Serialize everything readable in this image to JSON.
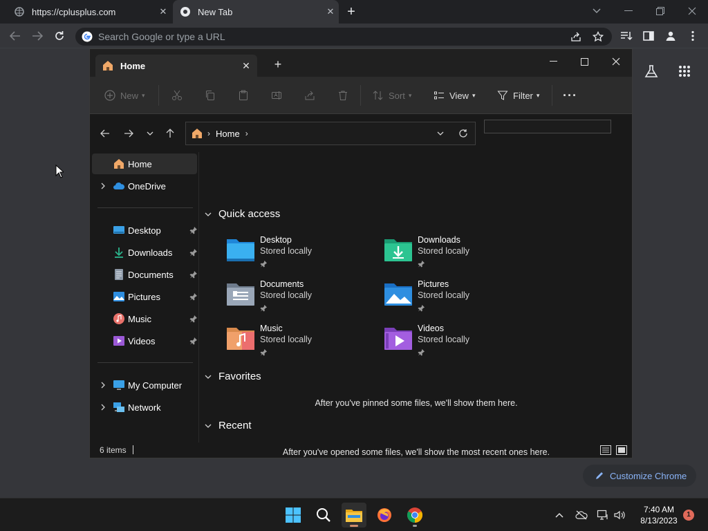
{
  "chrome": {
    "tabs": [
      {
        "label": "https://cplusplus.com",
        "close": "✕"
      },
      {
        "label": "New Tab",
        "close": "✕"
      }
    ],
    "newtab": "+",
    "omnibox": {
      "placeholder": "Search Google or type a URL"
    },
    "customize": "Customize Chrome"
  },
  "explorer": {
    "tab_title": "Home",
    "tab_close": "✕",
    "new_tab": "+",
    "commands": {
      "new": "New",
      "sort": "Sort",
      "view": "View",
      "filter": "Filter",
      "more": "···"
    },
    "address": {
      "segment": "Home"
    },
    "sidebar": {
      "home": "Home",
      "onedrive": "OneDrive",
      "pinned": [
        {
          "label": "Desktop",
          "icon": "desktop-folder-icon"
        },
        {
          "label": "Downloads",
          "icon": "downloads-folder-icon"
        },
        {
          "label": "Documents",
          "icon": "documents-folder-icon"
        },
        {
          "label": "Pictures",
          "icon": "pictures-folder-icon"
        },
        {
          "label": "Music",
          "icon": "music-folder-icon"
        },
        {
          "label": "Videos",
          "icon": "videos-folder-icon"
        }
      ],
      "my_computer": "My Computer",
      "network": "Network"
    },
    "sections": {
      "quick_access": "Quick access",
      "favorites": "Favorites",
      "recent": "Recent"
    },
    "quick_access": [
      {
        "name": "Desktop",
        "sub": "Stored locally"
      },
      {
        "name": "Downloads",
        "sub": "Stored locally"
      },
      {
        "name": "Documents",
        "sub": "Stored locally"
      },
      {
        "name": "Pictures",
        "sub": "Stored locally"
      },
      {
        "name": "Music",
        "sub": "Stored locally"
      },
      {
        "name": "Videos",
        "sub": "Stored locally"
      }
    ],
    "favorites_empty": "After you've pinned some files, we'll show them here.",
    "recent_empty": "After you've opened some files, we'll show the most recent ones here.",
    "status": "6 items"
  },
  "taskbar": {
    "time": "7:40 AM",
    "date": "8/13/2023",
    "notifications": "1"
  },
  "colors": {
    "accent_blue": "#8ab4f8",
    "folder_yellow": "#f5c544",
    "badge_red": "#e06a5a"
  }
}
